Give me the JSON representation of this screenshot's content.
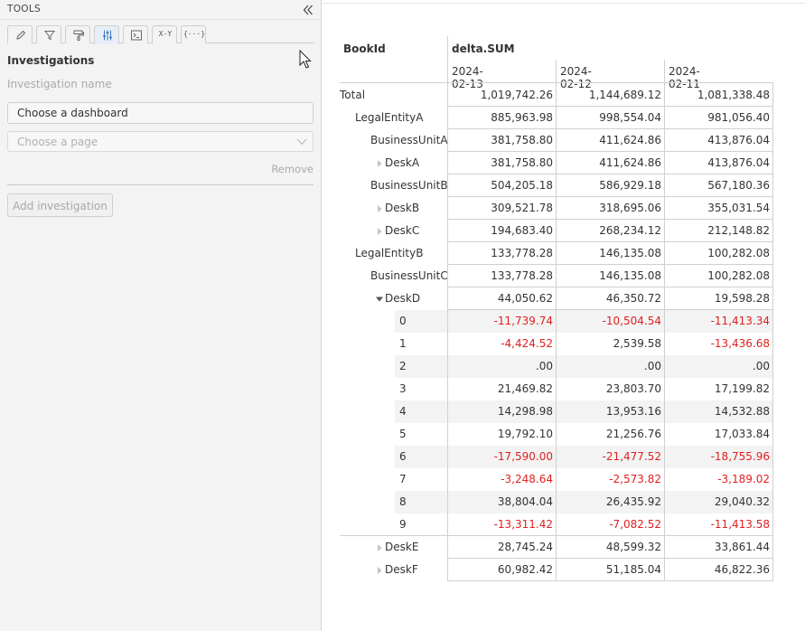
{
  "tools": {
    "title": "TOOLS",
    "tabs": [
      {
        "icon": "pencil-icon"
      },
      {
        "icon": "filter-icon"
      },
      {
        "icon": "paint-roller-icon"
      },
      {
        "icon": "sliders-icon"
      },
      {
        "icon": "terminal-icon"
      },
      {
        "icon": "xy-icon",
        "label": "X-Y"
      },
      {
        "icon": "braces-icon",
        "label": "{···}"
      }
    ],
    "section_title": "Investigations",
    "investigation_name_placeholder": "Investigation name",
    "dashboard_button": "Choose a dashboard",
    "page_select_placeholder": "Choose a page",
    "remove_label": "Remove",
    "add_investigation": "Add investigation"
  },
  "table": {
    "row_header": "BookId",
    "measure": "delta.SUM",
    "columns": [
      "2024-02-13",
      "2024-02-12",
      "2024-02-11"
    ],
    "rows": [
      {
        "label": "Total",
        "level": 0,
        "values": [
          "1,019,742.26",
          "1,144,689.12",
          "1,081,338.48"
        ]
      },
      {
        "label": "LegalEntityA",
        "level": 1,
        "values": [
          "885,963.98",
          "998,554.04",
          "981,056.40"
        ]
      },
      {
        "label": "BusinessUnitA",
        "level": 2,
        "values": [
          "381,758.80",
          "411,624.86",
          "413,876.04"
        ]
      },
      {
        "label": "DeskA",
        "level": 3,
        "expander": "collapsed",
        "values": [
          "381,758.80",
          "411,624.86",
          "413,876.04"
        ]
      },
      {
        "label": "BusinessUnitB",
        "level": 2,
        "values": [
          "504,205.18",
          "586,929.18",
          "567,180.36"
        ]
      },
      {
        "label": "DeskB",
        "level": 3,
        "expander": "collapsed",
        "values": [
          "309,521.78",
          "318,695.06",
          "355,031.54"
        ]
      },
      {
        "label": "DeskC",
        "level": 3,
        "expander": "collapsed",
        "values": [
          "194,683.40",
          "268,234.12",
          "212,148.82"
        ]
      },
      {
        "label": "LegalEntityB",
        "level": 1,
        "values": [
          "133,778.28",
          "146,135.08",
          "100,282.08"
        ]
      },
      {
        "label": "BusinessUnitC",
        "level": 2,
        "values": [
          "133,778.28",
          "146,135.08",
          "100,282.08"
        ]
      },
      {
        "label": "DeskD",
        "level": 3,
        "expander": "expanded",
        "values": [
          "44,050.62",
          "46,350.72",
          "19,598.28"
        ]
      },
      {
        "label": "0",
        "level": 4,
        "values": [
          "-11,739.74",
          "-10,504.54",
          "-11,413.34"
        ]
      },
      {
        "label": "1",
        "level": 4,
        "values": [
          "-4,424.52",
          "2,539.58",
          "-13,436.68"
        ]
      },
      {
        "label": "2",
        "level": 4,
        "values": [
          ".00",
          ".00",
          ".00"
        ]
      },
      {
        "label": "3",
        "level": 4,
        "values": [
          "21,469.82",
          "23,803.70",
          "17,199.82"
        ]
      },
      {
        "label": "4",
        "level": 4,
        "values": [
          "14,298.98",
          "13,953.16",
          "14,532.88"
        ]
      },
      {
        "label": "5",
        "level": 4,
        "values": [
          "19,792.10",
          "21,256.76",
          "17,033.84"
        ]
      },
      {
        "label": "6",
        "level": 4,
        "values": [
          "-17,590.00",
          "-21,477.52",
          "-18,755.96"
        ]
      },
      {
        "label": "7",
        "level": 4,
        "values": [
          "-3,248.64",
          "-2,573.82",
          "-3,189.02"
        ]
      },
      {
        "label": "8",
        "level": 4,
        "values": [
          "38,804.04",
          "26,435.92",
          "29,040.32"
        ]
      },
      {
        "label": "9",
        "level": 4,
        "values": [
          "-13,311.42",
          "-7,082.52",
          "-11,413.58"
        ]
      },
      {
        "label": "DeskE",
        "level": 3,
        "expander": "collapsed",
        "values": [
          "28,745.24",
          "48,599.32",
          "33,861.44"
        ]
      },
      {
        "label": "DeskF",
        "level": 3,
        "expander": "collapsed",
        "values": [
          "60,982.42",
          "51,185.04",
          "46,822.36"
        ]
      }
    ]
  },
  "colors": {
    "negative": "#e02020",
    "active_tab": "#e8eef7",
    "stripe": "#f3f3f3"
  }
}
